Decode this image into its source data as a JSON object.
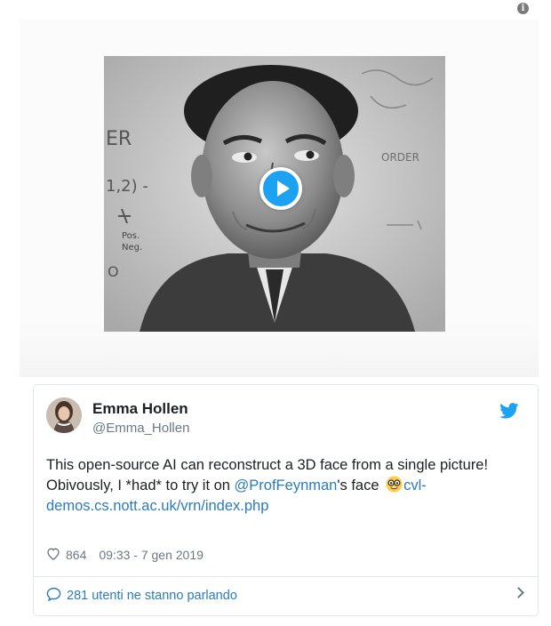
{
  "info_icon_glyph": "i",
  "media": {
    "play_icon": "play-icon",
    "background_lettering": [
      "ER",
      "1,2) -",
      "ORDER",
      "Pos.",
      "Neg.",
      "O"
    ]
  },
  "tweet": {
    "author_name": "Emma Hollen",
    "author_handle": "@Emma_Hollen",
    "text_line1": "This open-source AI can reconstruct a 3D face from a single picture!",
    "text_line2_before": "Obivously, I *had* to try it on ",
    "mention": "@ProfFeynman",
    "text_line2_after": "'s face ",
    "link": "cvl-demos.cs.nott.ac.uk/vrn/index.php",
    "like_count": "864",
    "timestamp": "09:33 - 7 gen 2019",
    "conversation_label": "281 utenti ne stanno parlando"
  },
  "colors": {
    "brand_blue": "#1da1f2",
    "link_blue": "#2b7bb9",
    "muted_text": "#697882",
    "border": "#e1e8ed"
  }
}
